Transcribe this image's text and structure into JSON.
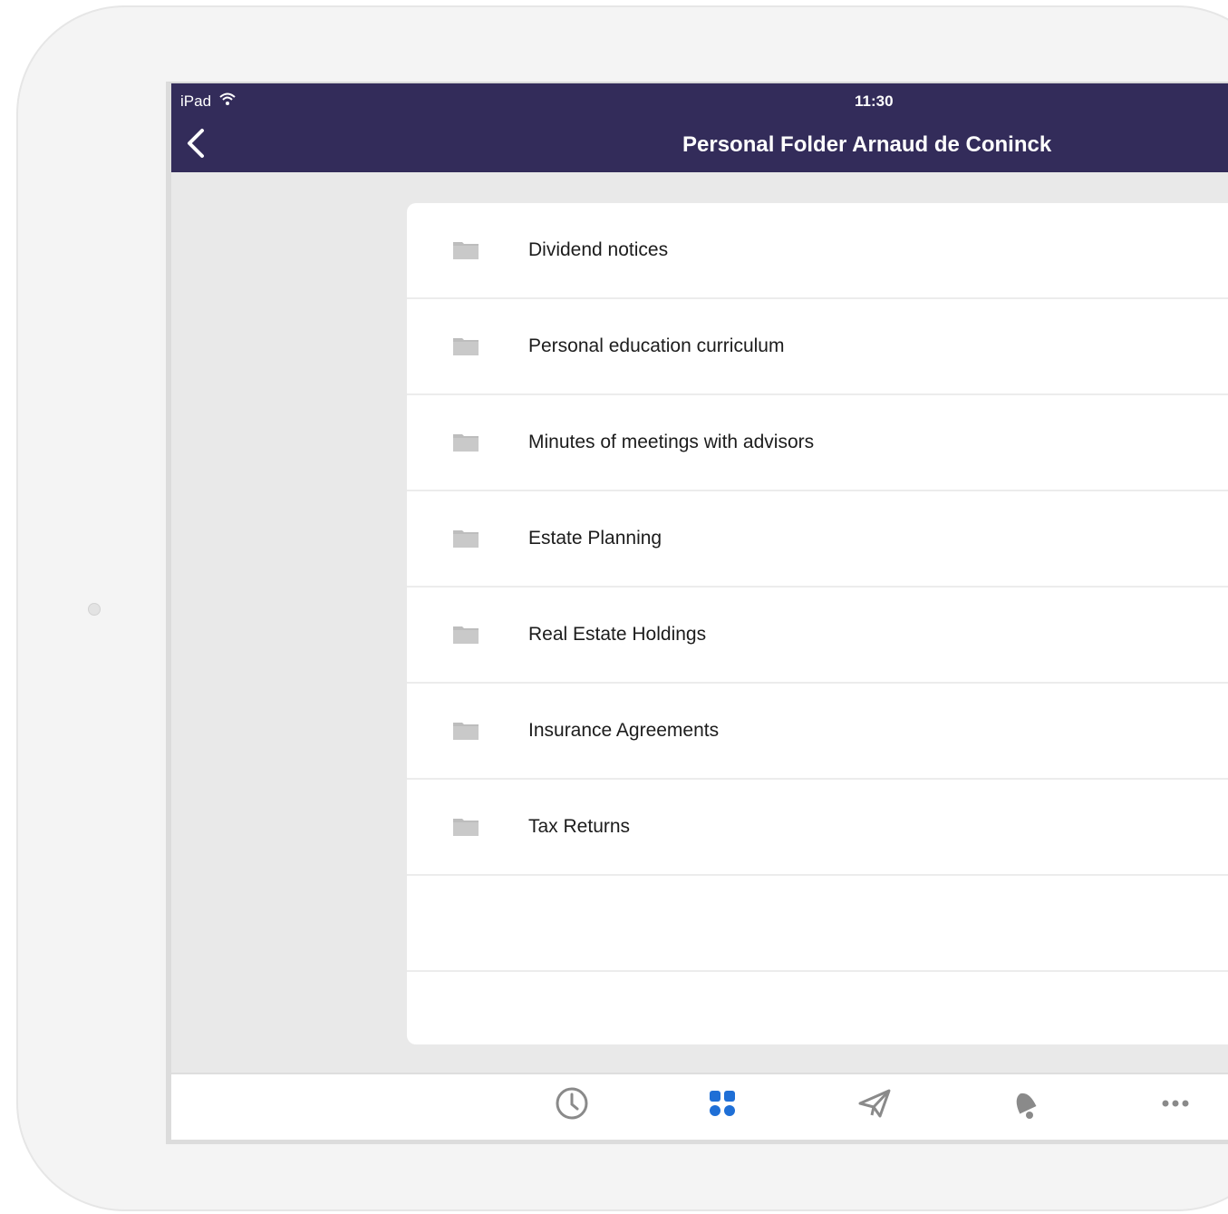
{
  "status_bar": {
    "device": "iPad",
    "time": "11:30"
  },
  "nav": {
    "title": "Personal Folder Arnaud de Coninck",
    "back_icon": "chevron-left-icon"
  },
  "folders": [
    {
      "label": "Dividend notices",
      "icon": "folder-icon"
    },
    {
      "label": "Personal education curriculum",
      "icon": "folder-icon"
    },
    {
      "label": "Minutes of meetings with advisors",
      "icon": "folder-icon"
    },
    {
      "label": "Estate Planning",
      "icon": "folder-icon"
    },
    {
      "label": "Real Estate Holdings",
      "icon": "folder-icon"
    },
    {
      "label": "Insurance Agreements",
      "icon": "folder-icon"
    },
    {
      "label": "Tax Returns",
      "icon": "folder-icon"
    }
  ],
  "tabbar": {
    "tabs": [
      {
        "icon": "clock-icon",
        "active": false
      },
      {
        "icon": "grid-icon",
        "active": true
      },
      {
        "icon": "paper-plane-icon",
        "active": false
      },
      {
        "icon": "bell-icon",
        "active": false
      },
      {
        "icon": "more-icon",
        "active": false
      }
    ]
  },
  "colors": {
    "nav_background": "#332c5a",
    "active_tab": "#1f6fd6",
    "inactive_tab": "#8a8a8a",
    "folder_icon": "#bdbdbd"
  }
}
